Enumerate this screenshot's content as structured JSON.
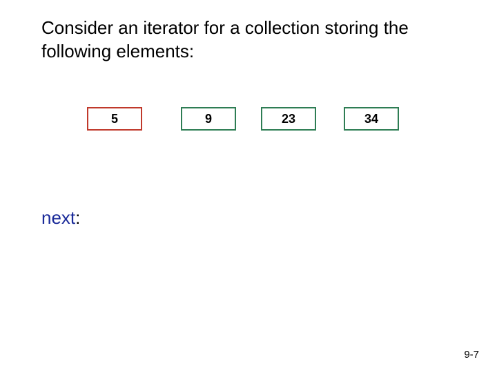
{
  "heading": "Consider an iterator for a collection storing the following elements:",
  "elements": [
    "5",
    "9",
    "23",
    "34"
  ],
  "highlight_index": 0,
  "next_label": "next",
  "next_colon": ":",
  "page_number": "9-7"
}
